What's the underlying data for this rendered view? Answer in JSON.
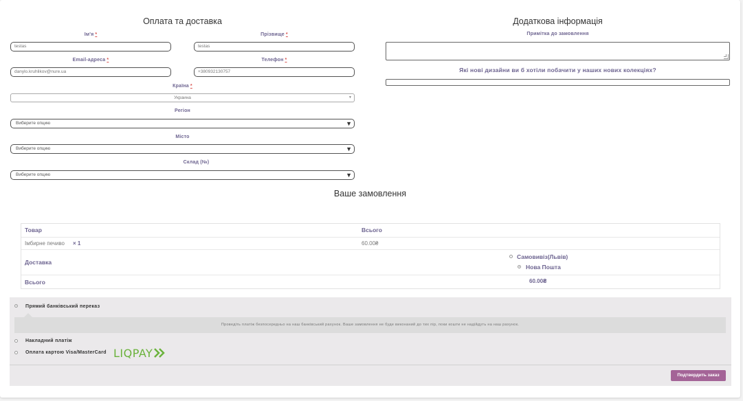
{
  "billing": {
    "title": "Оплата та доставка",
    "first_name_label": "Ім'я",
    "last_name_label": "Прізвище",
    "first_name_value": "testas",
    "last_name_value": "testas",
    "email_label": "Email-адреса",
    "phone_label": "Телефон",
    "email_value": "danylo.kruhlikov@nure.ua",
    "phone_value": "+380932130757",
    "required_mark": "*",
    "country_label": "Країна",
    "country_value": "Украина",
    "region_label": "Регіон",
    "region_value": "Виберите опцию",
    "city_label": "Місто",
    "city_value": "Виберите опцию",
    "warehouse_label": "Склад (№)",
    "warehouse_value": "Виберите опцию"
  },
  "additional": {
    "title": "Додаткова інформація",
    "note_label": "Примітка до замовлення",
    "question_label": "Які нові дизайни ви б хотіли побачити у наших нових колекціях?"
  },
  "order": {
    "title": "Ваше замовлення",
    "col_product": "Товар",
    "col_total": "Всього",
    "item_name": "Імбирне печиво",
    "item_qty": "× 1",
    "item_total": "60.00₴",
    "shipping_label": "Доставка",
    "shipping_options": [
      "Самовивіз(Львів)",
      "Нова Пошта"
    ],
    "total_label": "Всього",
    "total_value": "60.00₴"
  },
  "payment": {
    "methods": [
      "Прямий банківський переказ",
      "Накладний платіж",
      "Оплата картою Visa/MasterCard"
    ],
    "selected": 0,
    "bank_description": "Проведіть платіж безпосередньо на наш банківський рахунок. Ваше замовлення не буде виконаний до тих пір, поки кошти не надійдуть на наш рахунок.",
    "liqpay_logo": "LIQPAY",
    "submit_label": "Подтвердить заказ"
  }
}
